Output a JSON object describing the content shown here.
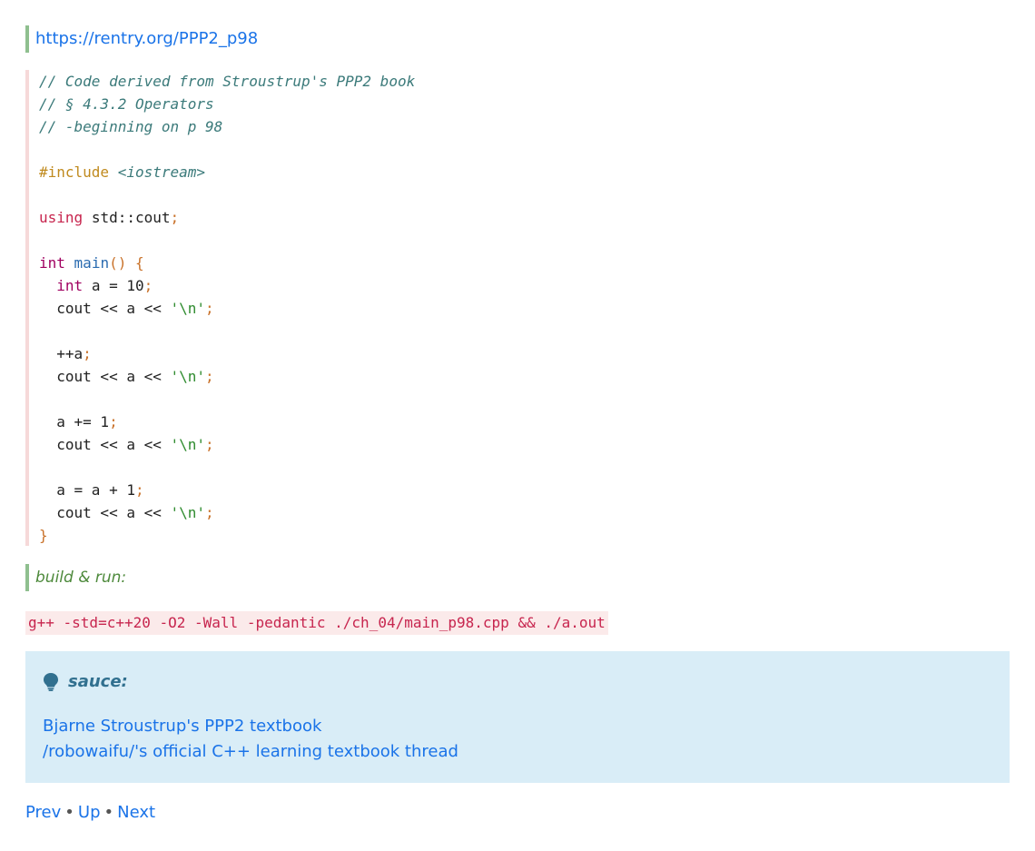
{
  "header": {
    "url_link": "https://rentry.org/PPP2_p98"
  },
  "code": {
    "comment1": "// Code derived from Stroustrup's PPP2 book",
    "comment2": "// § 4.3.2 Operators",
    "comment3": "// -beginning on p 98",
    "include_directive": "#include",
    "include_header": "<iostream>",
    "using_kw": "using",
    "using_target": "std::cout",
    "main_type": "int",
    "main_name": "main",
    "decl_type": "int",
    "decl_rest": "a = 10",
    "cout_stmt": "cout << a << ",
    "newline_literal": "'\\n'",
    "preincrement": "++a",
    "compound_assign": "a += 1",
    "plain_assign": "a = a + 1",
    "open_brace": "{",
    "close_brace": "}",
    "paren": "()",
    "semicolon": ";"
  },
  "build_label": "build & run:",
  "build_command": "g++ -std=c++20 -O2 -Wall -pedantic ./ch_04/main_p98.cpp && ./a.out",
  "note": {
    "title": "sauce:",
    "icon": "lightbulb-icon",
    "links": [
      "Bjarne Stroustrup's PPP2 textbook",
      "/robowaifu/'s official C++ learning textbook thread"
    ]
  },
  "nav": {
    "prev": "Prev",
    "up": "Up",
    "next": "Next",
    "separator": "•"
  },
  "colors": {
    "link": "#1a73e8",
    "note_bg": "#d9edf7",
    "note_title": "#31708f",
    "quote_border": "#8fbf8f",
    "code_border": "#f6d9d9"
  }
}
